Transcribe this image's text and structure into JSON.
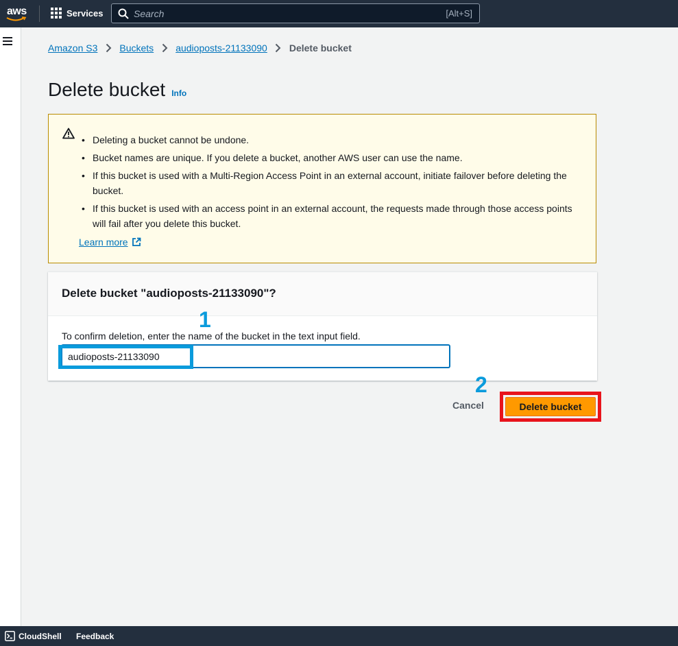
{
  "topnav": {
    "logo_text": "aws",
    "services_label": "Services",
    "search_placeholder": "Search",
    "search_shortcut": "[Alt+S]"
  },
  "breadcrumb": {
    "items": [
      "Amazon S3",
      "Buckets",
      "audioposts-21133090"
    ],
    "current": "Delete bucket"
  },
  "page": {
    "title": "Delete bucket",
    "info_label": "Info"
  },
  "warning": {
    "items": [
      "Deleting a bucket cannot be undone.",
      "Bucket names are unique. If you delete a bucket, another AWS user can use the name.",
      "If this bucket is used with a Multi-Region Access Point in an external account, initiate failover before deleting the bucket.",
      "If this bucket is used with an access point in an external account, the requests made through those access points will fail after you delete this bucket."
    ],
    "learn_more": "Learn more"
  },
  "confirm": {
    "title": "Delete bucket \"audioposts-21133090\"?",
    "description": "To confirm deletion, enter the name of the bucket in the text input field.",
    "input_value": "audioposts-21133090"
  },
  "annotations": {
    "step1": "1",
    "step2": "2"
  },
  "actions": {
    "cancel_label": "Cancel",
    "delete_label": "Delete bucket"
  },
  "footer": {
    "cloudshell_label": "CloudShell",
    "feedback_label": "Feedback"
  },
  "colors": {
    "nav_bg": "#232f3e",
    "link": "#0073bb",
    "primary_button": "#ff9900",
    "warning_bg": "#fffce9",
    "annotation_blue": "#0a9bdc",
    "annotation_red": "#e8141c"
  }
}
